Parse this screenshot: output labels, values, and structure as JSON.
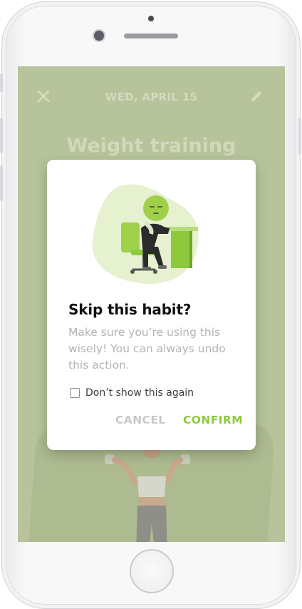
{
  "background": {
    "date": "WED, APRIL 15",
    "habit_title": "Weight training",
    "close_icon": "close-icon",
    "edit_icon": "pencil-icon"
  },
  "dialog": {
    "title": "Skip this habit?",
    "message": "Make sure you’re using this wisely! You can always undo this action.",
    "checkbox_label": "Don’t show this again",
    "checkbox_checked": false,
    "cancel_label": "CANCEL",
    "confirm_label": "CONFIRM",
    "illustration": "tired-person-at-desk-illustration"
  },
  "colors": {
    "accent": "#8dc93d",
    "overlay": "#b7c49b",
    "cancel": "#c8c8c8",
    "message": "#b3b3b3"
  }
}
